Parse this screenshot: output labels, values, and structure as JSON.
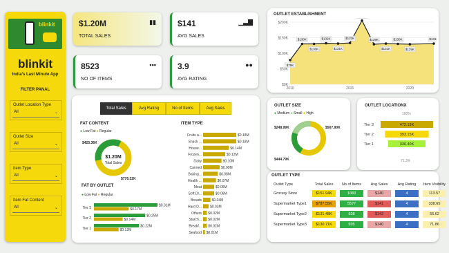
{
  "brand": {
    "name": "blinkit",
    "tagline": "India's Last Minute App",
    "logo_text": "blinkit",
    "filter_title": "FILTER PANAL"
  },
  "filters": [
    {
      "label": "Outlet Location Type",
      "value": "All"
    },
    {
      "label": "Outlet Size",
      "value": "All"
    },
    {
      "label": "Item Type",
      "value": "All"
    },
    {
      "label": "Item Fat Content",
      "value": "All"
    }
  ],
  "kpis": [
    {
      "value": "$1.20M",
      "label": "TOTAL SALES",
      "icon": "cash-icon"
    },
    {
      "value": "$141",
      "label": "AVG SALES",
      "icon": "bar-chart-icon"
    },
    {
      "value": "8523",
      "label": "NO OF ITEMS",
      "icon": "boxes-icon"
    },
    {
      "value": "3.9",
      "label": "AVG RATING",
      "icon": "people-icon"
    }
  ],
  "tabs": [
    "Total Sales",
    "Avg Rating",
    "No of Items",
    "Avg Sales"
  ],
  "colors": {
    "yellow": "#f5d90a",
    "green": "#2a9d3a",
    "dark": "#333333"
  },
  "fat_content": {
    "title": "FAT CONTENT",
    "legend": [
      "Low Fat",
      "Regular"
    ],
    "total": "$1.20M",
    "total_label": "Total Sales",
    "low_fat_label": "$776.32K",
    "regular_label": "$425.36K",
    "chart_data": {
      "type": "pie",
      "categories": [
        "Low Fat",
        "Regular"
      ],
      "values": [
        776.32,
        425.36
      ]
    }
  },
  "fat_by_outlet": {
    "title": "FAT BY OUTLET",
    "legend": [
      "Low Fat",
      "Regular"
    ],
    "chart_data": {
      "type": "bar",
      "categories": [
        "Tier 3",
        "Tier 2",
        "Tier 1"
      ],
      "series": [
        {
          "name": "Low Fat",
          "values": [
            0.31,
            0.25,
            0.22
          ],
          "labels": [
            "$0.31M",
            "$0.25M",
            "$0.22M"
          ]
        },
        {
          "name": "Regular",
          "values": [
            0.17,
            0.14,
            0.12
          ],
          "labels": [
            "$0.17M",
            "$0.14M",
            "$0.12M"
          ]
        }
      ]
    }
  },
  "item_type": {
    "title": "ITEM TYPE",
    "chart_data": {
      "type": "bar",
      "categories": [
        "Fruits a...",
        "Snack ...",
        "House...",
        "Frozen...",
        "Dairy",
        "Canned",
        "Baking...",
        "Health ...",
        "Meat",
        "Soft Dr...",
        "Breads",
        "Hard D...",
        "Others",
        "Starch...",
        "Breakf...",
        "Seafood"
      ],
      "values": [
        0.18,
        0.18,
        0.14,
        0.12,
        0.1,
        0.09,
        0.08,
        0.07,
        0.06,
        0.06,
        0.04,
        0.03,
        0.02,
        0.02,
        0.02,
        0.01
      ],
      "labels": [
        "$0.18M",
        "$0.18M",
        "$0.14M",
        "$0.12M",
        "$0.10M",
        "$0.09M",
        "$0.08M",
        "$0.07M",
        "$0.06M",
        "$0.06M",
        "$0.04M",
        "$0.03M",
        "$0.02M",
        "$0.02M",
        "$0.02M",
        "$0.01M"
      ]
    }
  },
  "outlet_establishment": {
    "title": "OUTLET ESTABLISHMENT",
    "chart_data": {
      "type": "area",
      "x": [
        2010,
        2011,
        2012,
        2013,
        2014,
        2015,
        2016,
        2017,
        2018,
        2019,
        2020,
        2022
      ],
      "values": [
        78,
        130,
        130,
        132,
        131,
        133,
        205,
        129,
        131,
        130,
        129,
        131
      ],
      "labels": [
        "$78K",
        "$130K",
        "$130K",
        "$132K",
        "$131K",
        "$133K",
        "$205K",
        "$129K",
        "$131K",
        "$130K",
        "$129K",
        "$131K"
      ],
      "y_ticks": [
        "$200K",
        "$150K",
        "$100K",
        "$50K",
        "$0K"
      ],
      "x_ticks": [
        "2010",
        "2015",
        "2020"
      ],
      "ylim": [
        0,
        200
      ]
    }
  },
  "outlet_size": {
    "title": "OUTLET SIZE",
    "legend": [
      "Medium",
      "Small",
      "High"
    ],
    "labels": [
      "$507.90K",
      "$248.99K",
      "$444.79K"
    ],
    "chart_data": {
      "type": "pie",
      "categories": [
        "Medium",
        "Small",
        "High"
      ],
      "values": [
        507.9,
        444.79,
        248.99
      ]
    }
  },
  "outlet_location": {
    "title": "OUTLET LOCATIONX",
    "top_pct": "100%",
    "bottom_pct": "71.3%",
    "chart_data": {
      "type": "bar",
      "categories": [
        "Tier 3",
        "Tier 2",
        "Tier 1"
      ],
      "values": [
        472.13,
        393.15,
        336.4
      ],
      "labels": [
        "472.13K",
        "393.15K",
        "336.40K"
      ]
    }
  },
  "outlet_type": {
    "title": "OUTLET TYPE",
    "headers": [
      "Outlet Type",
      "Total Sales",
      "No of Items",
      "Avg Sales",
      "Avg Rating",
      "Item Visibility"
    ],
    "rows": [
      [
        "Grocery Store",
        "$151.94K",
        "1083",
        "$140",
        "4",
        "113.57"
      ],
      [
        "Supermarket Type1",
        "$787.55K",
        "5577",
        "$141",
        "4",
        "338.65"
      ],
      [
        "Supermarket Type2",
        "$131.48K",
        "928",
        "$142",
        "4",
        "56.62"
      ],
      [
        "Supermarket Type3",
        "$130.71K",
        "935",
        "$140",
        "4",
        "71.86"
      ]
    ]
  }
}
